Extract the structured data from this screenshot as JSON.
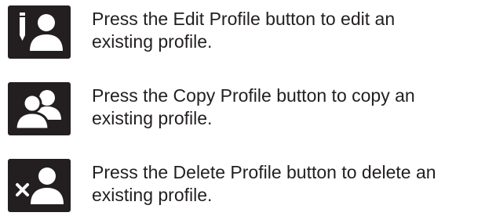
{
  "items": [
    {
      "icon": "edit-profile-icon",
      "line1": "Press the Edit Profile button to edit an",
      "line2": "existing profile."
    },
    {
      "icon": "copy-profile-icon",
      "line1": "Press the Copy Profile button to copy an",
      "line2": "existing profile."
    },
    {
      "icon": "delete-profile-icon",
      "line1": "Press the Delete Profile button to delete an",
      "line2": "existing profile."
    }
  ],
  "colors": {
    "icon_background": "#231f20",
    "icon_foreground": "#ffffff",
    "text": "#231f20"
  }
}
